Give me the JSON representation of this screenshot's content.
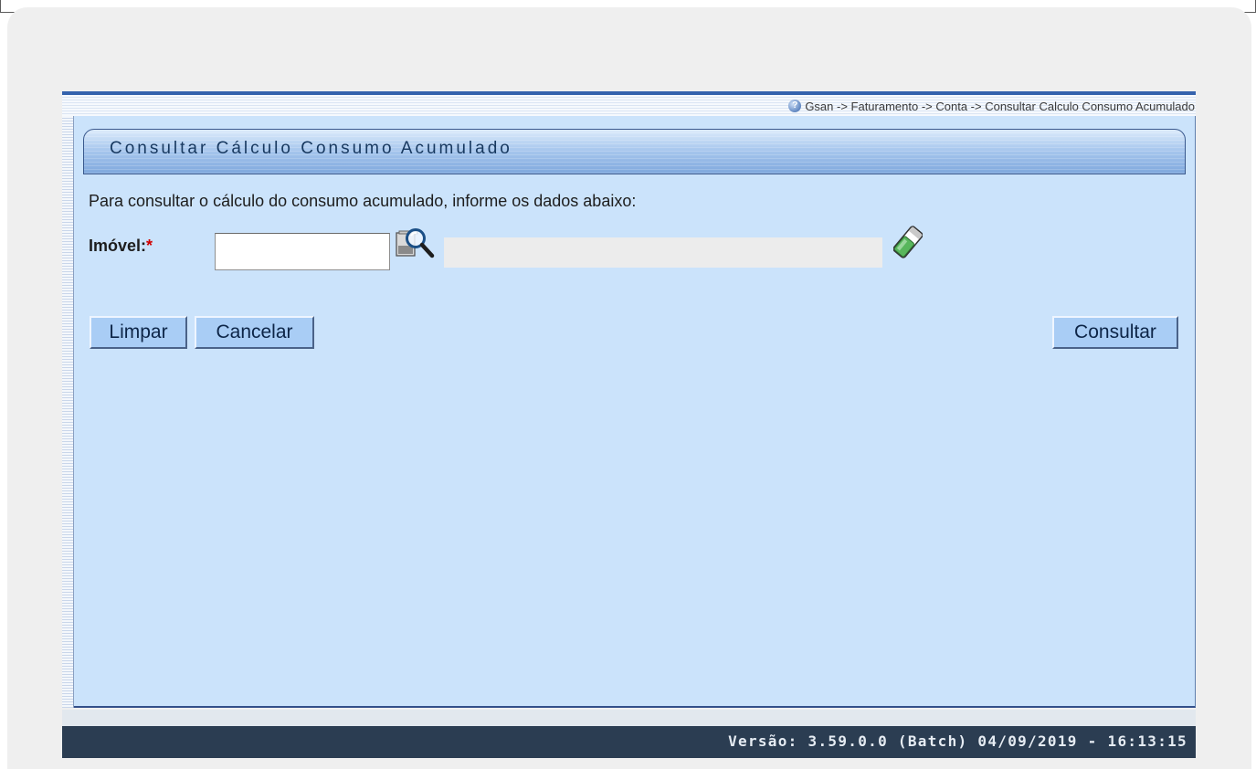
{
  "breadcrumb": {
    "icon": "help-icon",
    "text": "Gsan -> Faturamento -> Conta -> Consultar Calculo Consumo Acumulado"
  },
  "page": {
    "title": "Consultar Cálculo Consumo Acumulado",
    "instruction": "Para consultar o cálculo do consumo acumulado, informe os dados abaixo:"
  },
  "form": {
    "imovel_label": "Imóvel:",
    "required_mark": "*",
    "imovel_value": "",
    "imovel_description": "",
    "search_icon": "search-icon",
    "clear_icon": "eraser-icon"
  },
  "buttons": {
    "limpar": "Limpar",
    "cancelar": "Cancelar",
    "consultar": "Consultar"
  },
  "footer": {
    "version": "Versão: 3.59.0.0 (Batch) 04/09/2019 - 16:13:15"
  },
  "colors": {
    "content_bg": "#cbe3fb",
    "footer_bg": "#2b3d52",
    "button_bg": "#a9cdf5",
    "required": "#d10000"
  }
}
